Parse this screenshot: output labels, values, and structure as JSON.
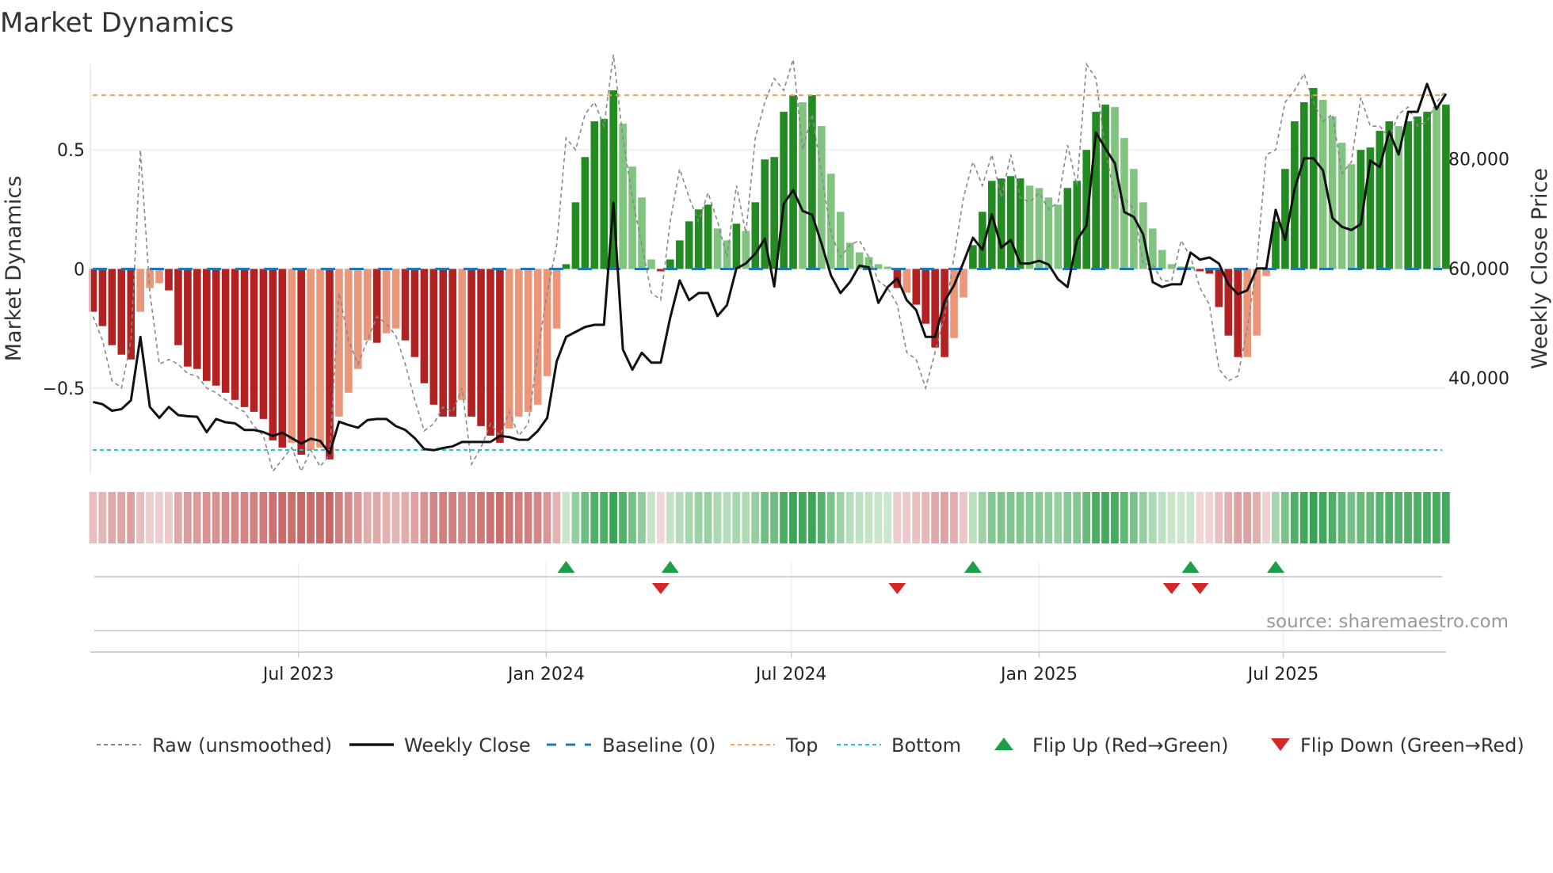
{
  "chart_data": {
    "type": "bar",
    "title": "Market Dynamics",
    "ylabel": "Market Dynamics",
    "y2label": "Weekly Close Price",
    "ylim": [
      -0.86,
      0.86
    ],
    "y2lim": [
      22500,
      97300
    ],
    "yticks": [
      {
        "v": 0.5,
        "label": "0.5"
      },
      {
        "v": 0,
        "label": "0"
      },
      {
        "v": -0.5,
        "label": "−0.5"
      }
    ],
    "y2ticks": [
      {
        "v": 80000,
        "label": "80,000"
      },
      {
        "v": 60000,
        "label": "60,000"
      },
      {
        "v": 40000,
        "label": "40,000"
      }
    ],
    "xticks": [
      {
        "week": 21.7,
        "label": "Jul 2023"
      },
      {
        "week": 47.9,
        "label": "Jan 2024"
      },
      {
        "week": 73.8,
        "label": "Jul 2024"
      },
      {
        "week": 100,
        "label": "Jan 2025"
      },
      {
        "week": 125.8,
        "label": "Jul 2025"
      }
    ],
    "top_level": 0.73,
    "bottom_level": -0.76,
    "baseline": 0,
    "values": [
      -0.18,
      -0.24,
      -0.32,
      -0.36,
      -0.38,
      -0.18,
      -0.08,
      -0.06,
      -0.09,
      -0.32,
      -0.41,
      -0.42,
      -0.47,
      -0.49,
      -0.52,
      -0.55,
      -0.58,
      -0.6,
      -0.63,
      -0.72,
      -0.75,
      -0.73,
      -0.78,
      -0.76,
      -0.75,
      -0.8,
      -0.62,
      -0.52,
      -0.42,
      -0.3,
      -0.31,
      -0.27,
      -0.25,
      -0.3,
      -0.37,
      -0.48,
      -0.57,
      -0.62,
      -0.62,
      -0.55,
      -0.62,
      -0.66,
      -0.7,
      -0.73,
      -0.67,
      -0.62,
      -0.6,
      -0.57,
      -0.45,
      -0.25,
      0.02,
      0.28,
      0.47,
      0.62,
      0.63,
      0.75,
      0.61,
      0.43,
      0.3,
      0.04,
      -0.01,
      0.04,
      0.12,
      0.2,
      0.25,
      0.27,
      0.17,
      0.12,
      0.19,
      0.16,
      0.28,
      0.46,
      0.47,
      0.66,
      0.73,
      0.7,
      0.73,
      0.6,
      0.4,
      0.24,
      0.11,
      0.07,
      0.05,
      0.02,
      0.01,
      -0.08,
      -0.1,
      -0.15,
      -0.23,
      -0.33,
      -0.37,
      -0.29,
      -0.12,
      0.1,
      0.24,
      0.37,
      0.38,
      0.39,
      0.38,
      0.35,
      0.34,
      0.3,
      0.27,
      0.34,
      0.37,
      0.5,
      0.66,
      0.69,
      0.68,
      0.55,
      0.42,
      0.28,
      0.17,
      0.08,
      0.02,
      0.01,
      0.01,
      -0.01,
      -0.02,
      -0.16,
      -0.28,
      -0.37,
      -0.37,
      -0.28,
      -0.03,
      0.2,
      0.42,
      0.62,
      0.7,
      0.76,
      0.71,
      0.64,
      0.53,
      0.44,
      0.5,
      0.51,
      0.58,
      0.62,
      0.6,
      0.62,
      0.64,
      0.66,
      0.68,
      0.69
    ],
    "strong": [
      1,
      1,
      1,
      1,
      1,
      0,
      0,
      0,
      1,
      1,
      1,
      1,
      1,
      1,
      1,
      1,
      1,
      1,
      1,
      1,
      1,
      0,
      1,
      0,
      0,
      1,
      0,
      0,
      0,
      0,
      1,
      0,
      0,
      1,
      1,
      1,
      1,
      1,
      1,
      0,
      1,
      1,
      1,
      1,
      0,
      0,
      0,
      0,
      0,
      0,
      1,
      1,
      1,
      1,
      1,
      1,
      0,
      0,
      0,
      0,
      1,
      1,
      1,
      1,
      1,
      1,
      0,
      0,
      1,
      0,
      1,
      1,
      1,
      1,
      1,
      0,
      1,
      0,
      0,
      0,
      0,
      0,
      0,
      0,
      0,
      1,
      0,
      1,
      1,
      1,
      1,
      0,
      0,
      1,
      1,
      1,
      1,
      1,
      1,
      0,
      0,
      0,
      0,
      1,
      1,
      1,
      1,
      1,
      0,
      0,
      0,
      0,
      0,
      0,
      0,
      0,
      0,
      1,
      1,
      1,
      1,
      1,
      0,
      0,
      0,
      1,
      1,
      1,
      1,
      1,
      0,
      0,
      0,
      0,
      1,
      1,
      1,
      1,
      0,
      1,
      1,
      1,
      0,
      1
    ],
    "raw": [
      -0.2,
      -0.3,
      -0.47,
      -0.5,
      -0.3,
      0.5,
      -0.1,
      -0.4,
      -0.38,
      -0.4,
      -0.44,
      -0.45,
      -0.5,
      -0.52,
      -0.55,
      -0.58,
      -0.6,
      -0.66,
      -0.7,
      -0.85,
      -0.8,
      -0.75,
      -0.85,
      -0.76,
      -0.83,
      -0.78,
      -0.1,
      -0.3,
      -0.4,
      -0.3,
      -0.2,
      -0.23,
      -0.28,
      -0.4,
      -0.55,
      -0.68,
      -0.65,
      -0.58,
      -0.6,
      -0.5,
      -0.82,
      -0.75,
      -0.65,
      -0.7,
      -0.6,
      -0.7,
      -0.65,
      -0.35,
      -0.1,
      0.1,
      0.55,
      0.5,
      0.65,
      0.7,
      0.6,
      0.9,
      0.55,
      0.3,
      0.1,
      -0.1,
      -0.13,
      0.2,
      0.42,
      0.3,
      0.2,
      0.32,
      0.2,
      0.05,
      0.35,
      0.15,
      0.55,
      0.7,
      0.8,
      0.75,
      0.88,
      0.5,
      0.65,
      0.4,
      0.15,
      0.05,
      0.1,
      0.12,
      0.05,
      -0.05,
      -0.08,
      -0.15,
      -0.35,
      -0.38,
      -0.5,
      -0.35,
      -0.2,
      0.05,
      0.3,
      0.45,
      0.35,
      0.48,
      0.3,
      0.48,
      0.3,
      0.28,
      0.32,
      0.25,
      0.28,
      0.52,
      0.35,
      0.86,
      0.8,
      0.5,
      0.3,
      0.3,
      0.25,
      0.02,
      0.02,
      -0.05,
      -0.05,
      0.12,
      0.05,
      -0.08,
      -0.15,
      -0.42,
      -0.47,
      -0.45,
      -0.25,
      0.02,
      0.48,
      0.5,
      0.7,
      0.75,
      0.82,
      0.7,
      0.62,
      0.65,
      0.4,
      0.45,
      0.72,
      0.6,
      0.6,
      0.55,
      0.65,
      0.68,
      0.6,
      0.62,
      0.7,
      0.75
    ],
    "close": [
      35600,
      35200,
      34000,
      34300,
      35900,
      47500,
      34700,
      32700,
      34700,
      33200,
      33000,
      32900,
      30100,
      32500,
      31900,
      31700,
      30500,
      30500,
      30100,
      29400,
      30000,
      29000,
      28000,
      28900,
      28500,
      26200,
      32000,
      31400,
      30900,
      32300,
      32500,
      32500,
      31200,
      30500,
      29000,
      27000,
      26800,
      27200,
      27500,
      28300,
      28300,
      28300,
      28300,
      29400,
      29200,
      28700,
      28700,
      30300,
      32700,
      43000,
      47500,
      48400,
      49300,
      49700,
      49700,
      72000,
      45200,
      41500,
      44600,
      42800,
      42800,
      51000,
      57800,
      54200,
      55500,
      55500,
      51300,
      53300,
      60000,
      60900,
      62700,
      65400,
      56700,
      71800,
      74300,
      70500,
      69800,
      64500,
      58700,
      55500,
      57500,
      60500,
      60200,
      53700,
      56600,
      58200,
      54200,
      52400,
      47500,
      47500,
      54000,
      56900,
      61100,
      65600,
      63400,
      69900,
      63800,
      65200,
      60900,
      60900,
      61400,
      60700,
      58000,
      56600,
      65200,
      67800,
      84800,
      81900,
      79200,
      70300,
      69400,
      66200,
      57500,
      56600,
      57100,
      57100,
      62900,
      61600,
      62000,
      60900,
      57100,
      55300,
      56000,
      60000,
      60000,
      70700,
      65200,
      74500,
      80100,
      80100,
      77900,
      69200,
      67600,
      67000,
      68100,
      79700,
      78500,
      85000,
      80800,
      88600,
      88600,
      93700,
      89100,
      91900
    ],
    "flip_up_weeks": [
      50,
      61,
      93,
      116,
      125
    ],
    "flip_down_weeks": [
      60,
      85,
      114,
      117
    ],
    "legend": {
      "placement": "bottom",
      "items": [
        {
          "label": "Raw (unsmoothed)",
          "kind": "dashed",
          "color": "#888888"
        },
        {
          "label": "Weekly Close",
          "kind": "solid",
          "color": "#111111"
        },
        {
          "label": "Baseline (0)",
          "kind": "dash",
          "color": "#1f77b4"
        },
        {
          "label": "Top",
          "kind": "dotted",
          "color": "#f0a060"
        },
        {
          "label": "Bottom",
          "kind": "dotted",
          "color": "#22c5d8"
        },
        {
          "label": "Flip Up (Red→Green)",
          "kind": "up",
          "color": "#1f9e49"
        },
        {
          "label": "Flip Down (Green→Red)",
          "kind": "down",
          "color": "#d62728"
        }
      ]
    },
    "colors": {
      "red_strong": "#b22222",
      "red_weak": "#e9967a",
      "green_strong": "#228b22",
      "green_weak": "#80c480"
    }
  },
  "source": "source: sharemaestro.com"
}
